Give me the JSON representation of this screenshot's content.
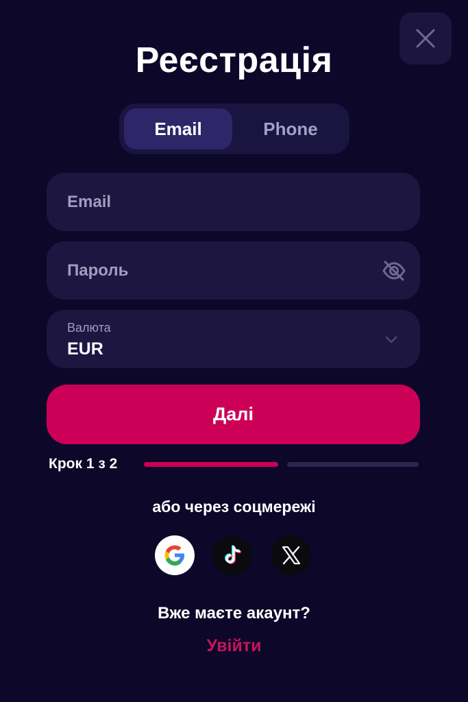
{
  "title": "Реєстрація",
  "tabs": [
    {
      "label": "Email",
      "active": true
    },
    {
      "label": "Phone",
      "active": false
    }
  ],
  "form": {
    "email_placeholder": "Email",
    "password_placeholder": "Пароль",
    "currency_label": "Валюта",
    "currency_value": "EUR"
  },
  "submit_label": "Далі",
  "step": {
    "label": "Крок 1 з 2",
    "current": 1,
    "total": 2
  },
  "social": {
    "heading": "або через соцмережі",
    "providers": [
      "google-icon",
      "tiktok-icon",
      "x-icon"
    ]
  },
  "footer": {
    "question": "Вже маєте акаунт?",
    "login_label": "Увійти"
  },
  "colors": {
    "background": "#0d0729",
    "field": "#1c1640",
    "accent": "#cc0057",
    "active_tab": "#2d2668"
  }
}
